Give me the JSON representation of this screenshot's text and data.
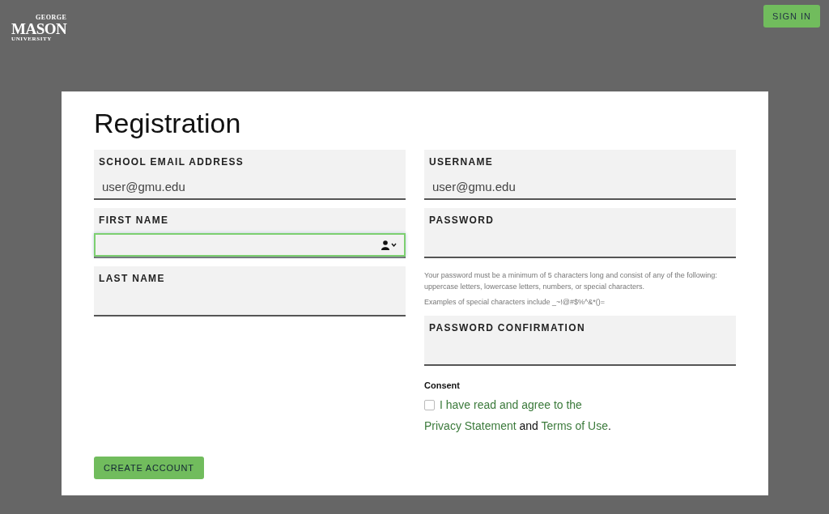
{
  "header": {
    "logo": {
      "top": "GEORGE",
      "main": "MASON",
      "bottom": "UNIVERSITY"
    },
    "sign_in": "SIGN IN"
  },
  "form": {
    "title": "Registration",
    "left_fields": [
      {
        "label": "SCHOOL EMAIL ADDRESS",
        "placeholder": "user@gmu.edu",
        "focused": false,
        "autofill_icon": false
      },
      {
        "label": "FIRST NAME",
        "focused": true,
        "autofill_icon": true
      },
      {
        "label": "LAST NAME",
        "focused": false,
        "autofill_icon": false
      }
    ],
    "right_fields": [
      {
        "label": "USERNAME",
        "placeholder": "user@gmu.edu",
        "focused": false,
        "autofill_icon": false
      },
      {
        "label": "PASSWORD",
        "focused": false,
        "autofill_icon": false,
        "help": [
          "Your password must be a minimum of 5 characters long and consist of any of the following: uppercase letters, lowercase letters, numbers, or special characters.",
          "Examples of special characters include _~!@#$%^&*()="
        ]
      },
      {
        "label": "PASSWORD CONFIRMATION",
        "focused": false,
        "autofill_icon": false
      }
    ],
    "consent": {
      "heading": "Consent",
      "checked": false,
      "label": "I have read and agree to the",
      "link_1": "Privacy Statement",
      "joiner": "and",
      "link_2": "Terms of Use",
      "end": "."
    },
    "submit": "CREATE ACCOUNT"
  }
}
